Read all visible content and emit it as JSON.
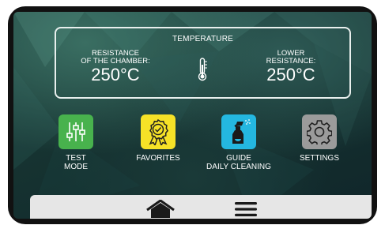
{
  "temperature": {
    "title": "TEMPERATURE",
    "left": {
      "label_line1": "RESISTANCE",
      "label_line2": "OF THE CHAMBER:",
      "value": "250°C"
    },
    "right": {
      "label_line1": "LOWER",
      "label_line2": "RESISTANCE:",
      "value": "250°C"
    },
    "icon": "thermometer-icon"
  },
  "tiles": [
    {
      "name": "test-mode",
      "label_line1": "TEST",
      "label_line2": "MODE",
      "icon": "sliders-icon",
      "color": "#48b24d"
    },
    {
      "name": "favorites",
      "label_line1": "FAVORITES",
      "label_line2": "",
      "icon": "award-ribbon-icon",
      "color": "#f6e227"
    },
    {
      "name": "guide-daily-cleaning",
      "label_line1": "GUIDE",
      "label_line2": "DAILY CLEANING",
      "icon": "spray-bottle-icon",
      "color": "#24b7e0"
    },
    {
      "name": "settings",
      "label_line1": "SETTINGS",
      "label_line2": "",
      "icon": "gear-icon",
      "color": "#9b9b9b"
    }
  ],
  "bottom_bar": {
    "home_icon": "home-icon",
    "menu_icon": "hamburger-menu-icon"
  }
}
